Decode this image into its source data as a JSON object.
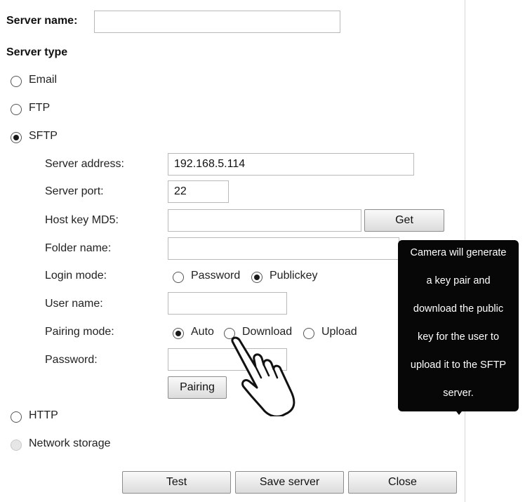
{
  "server_name": {
    "label": "Server name:",
    "value": ""
  },
  "server_type": {
    "heading": "Server type",
    "email": "Email",
    "ftp": "FTP",
    "sftp": "SFTP",
    "http": "HTTP",
    "network_storage": "Network storage",
    "selected": "SFTP"
  },
  "sftp": {
    "server_address": {
      "label": "Server address:",
      "value": "192.168.5.114"
    },
    "server_port": {
      "label": "Server port:",
      "value": "22"
    },
    "host_key": {
      "label": "Host key MD5:",
      "value": "",
      "get_label": "Get"
    },
    "folder_name": {
      "label": "Folder name:",
      "value": ""
    },
    "login_mode": {
      "label": "Login mode:",
      "password": "Password",
      "publickey": "Publickey",
      "selected": "Publickey"
    },
    "user_name": {
      "label": "User name:",
      "value": ""
    },
    "pairing_mode": {
      "label": "Pairing mode:",
      "auto": "Auto",
      "download": "Download",
      "upload": "Upload",
      "selected": "Auto"
    },
    "password": {
      "label": "Password:",
      "value": ""
    },
    "pairing_label": "Pairing"
  },
  "tooltip": {
    "lines": [
      "Camera will generate",
      "a key pair and",
      "download the public",
      "key for the user to",
      "upload it to the SFTP",
      "server."
    ]
  },
  "footer": {
    "test_label": "Test",
    "save_label": "Save server",
    "close_label": "Close"
  },
  "icons": {
    "pointer": "hand-pointer-icon"
  }
}
